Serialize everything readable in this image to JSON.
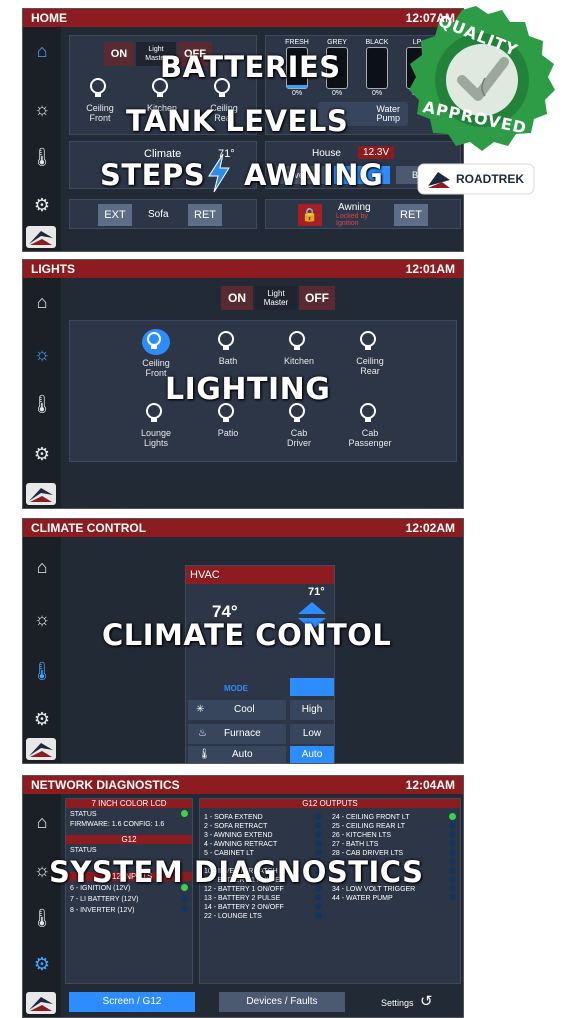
{
  "home": {
    "title": "HOME",
    "time": "12:07AM",
    "on": "ON",
    "off": "OFF",
    "light_master": "Light\nMaster",
    "lights": [
      "Ceiling\nFront",
      "Kitchen",
      "Ceiling\nRear"
    ],
    "climate_label": "Climate",
    "climate_temp": "71°",
    "tank_labels": [
      "FRESH",
      "GREY",
      "BLACK",
      "LP"
    ],
    "tank_values": [
      "0%",
      "0%",
      "0%",
      "0%"
    ],
    "water_pump": "Water\nPump",
    "house_label": "House",
    "house_voltage": "12.3V",
    "inverter": "Inverter",
    "battery": "Batter",
    "ext": "EXT",
    "sofa": "Sofa",
    "ret": "RET",
    "awning": "Awning",
    "awning_status": "Locked by\nIgnition",
    "awning_ret": "RET"
  },
  "overlays": {
    "batteries": "BATTERIES",
    "tank_levels": "TANK LEVELS",
    "steps": "STEPS",
    "awning": "AWNING",
    "lighting": "LIGHTING",
    "climate": "CLIMATE CONTOL",
    "diagnostics": "SYSTEM DIAGNOSTICS"
  },
  "badge": {
    "top": "QUALITY",
    "bottom": "APPROVED",
    "brand": "ROADTREK"
  },
  "lights_screen": {
    "title": "LIGHTS",
    "time": "12:01AM",
    "on": "ON",
    "off": "OFF",
    "light_master": "Light\nMaster",
    "lights": [
      "Ceiling\nFront",
      "Bath",
      "Kitchen",
      "Ceiling\nRear",
      "Lounge\nLights",
      "Patio",
      "Cab\nDriver",
      "Cab\nPassenger"
    ]
  },
  "climate_screen": {
    "title": "CLIMATE CONTROL",
    "time": "12:02AM",
    "hvac": "HVAC",
    "current_temp": "74°",
    "set_temp": "71°",
    "mode": "MODE",
    "modes": [
      "Cool",
      "Furnace",
      "Auto"
    ],
    "fans": [
      "High",
      "Low",
      "Auto"
    ]
  },
  "diag_screen": {
    "title": "NETWORK DIAGNOSTICS",
    "time": "12:04AM",
    "lcd_title": "7 INCH COLOR LCD",
    "status": "STATUS",
    "firmware": "FIRMWARE: 1.6  CONFIG: 1.6",
    "g12": "G12",
    "g12_status": "STATUS",
    "g12_inputs": "G12 INPUTS",
    "inputs": [
      "6 - IGNITION (12V)",
      "7 - LI BATTERY (12V)",
      "8 - INVERTER (12V)"
    ],
    "outputs_title": "G12 OUTPUTS",
    "outputs_left": [
      "1 - SOFA EXTEND",
      "2 - SOFA RETRACT",
      "3 - AWNING EXTEND",
      "4 - AWNING RETRACT",
      "5 - CABINET LT",
      "",
      "10 - INVERTER LATCH",
      "11 - BATTERY 1 PULSE",
      "12 - BATTERY 1 ON/OFF",
      "13 - BATTERY 2 PULSE",
      "14 - BATTERY 2 ON/OFF",
      "22 - LOUNGE LTS"
    ],
    "outputs_right": [
      "24 - CEILING FRONT LT",
      "25 - CEILING REAR LT",
      "26 - KITCHEN LTS",
      "27 - BATH LTS",
      "28 - CAB DRIVER LTS",
      "",
      "",
      "",
      "34 - LOW VOLT TRIGGER",
      "44 - WATER PUMP"
    ],
    "tab_screen": "Screen / G12",
    "tab_devices": "Devices / Faults",
    "settings": "Settings"
  }
}
